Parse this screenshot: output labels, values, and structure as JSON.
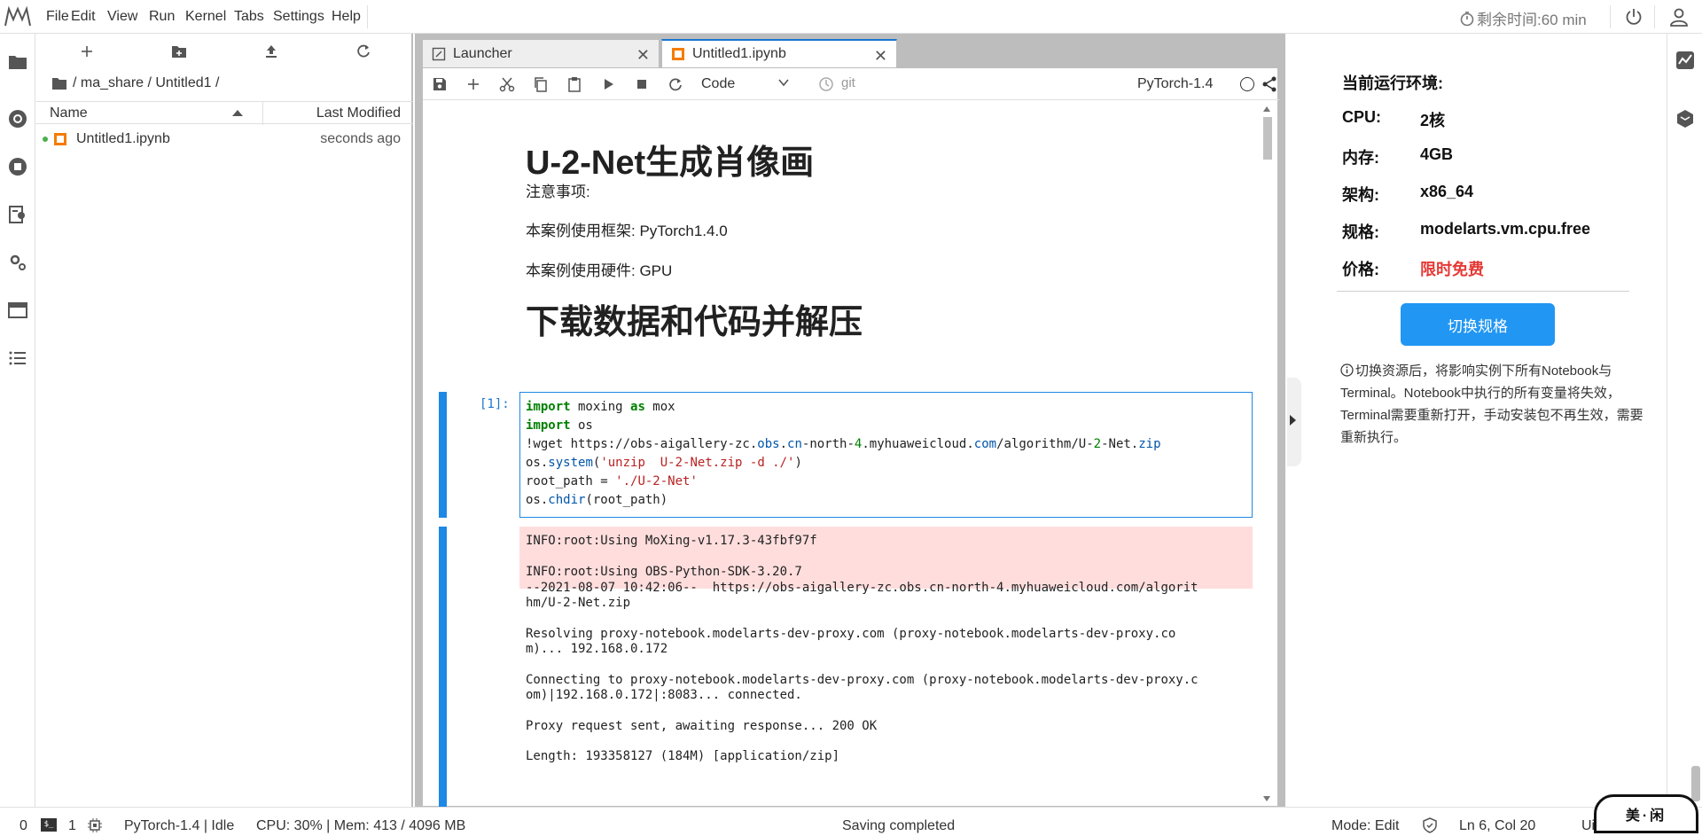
{
  "menubar": {
    "items": [
      "File",
      "Edit",
      "View",
      "Run",
      "Kernel",
      "Tabs",
      "Settings",
      "Help"
    ],
    "timer_label": "剩余时间:60 min"
  },
  "filebrowser": {
    "breadcrumb": "/ ma_share / Untitled1 /",
    "col_name": "Name",
    "col_modified": "Last Modified",
    "files": [
      {
        "name": "Untitled1.ipynb",
        "modified": "seconds ago"
      }
    ]
  },
  "tabs": {
    "launcher": "Launcher",
    "notebook": "Untitled1.ipynb"
  },
  "toolbar": {
    "cell_type": "Code",
    "git_label": "git",
    "kernel": "PyTorch-1.4"
  },
  "notebook": {
    "title": "U-2-Net生成肖像画",
    "note_heading": "注意事项:",
    "framework": "本案例使用框架: PyTorch1.4.0",
    "hardware": "本案例使用硬件: GPU",
    "section2": "下载数据和代码并解压",
    "prompt": "[1]:",
    "code_lines": [
      "import moxing as mox",
      "import os",
      "!wget https://obs-aigallery-zc.obs.cn-north-4.myhuaweicloud.com/algorithm/U-2-Net.zip",
      "os.system('unzip  U-2-Net.zip -d ./')",
      "root_path = './U-2-Net'",
      "os.chdir(root_path)"
    ],
    "stderr_lines": [
      "INFO:root:Using MoXing-v1.17.3-43fbf97f",
      "",
      "INFO:root:Using OBS-Python-SDK-3.20.7"
    ],
    "stdout_lines": [
      "--2021-08-07 10:42:06--  https://obs-aigallery-zc.obs.cn-north-4.myhuaweicloud.com/algorit",
      "hm/U-2-Net.zip",
      "",
      "Resolving proxy-notebook.modelarts-dev-proxy.com (proxy-notebook.modelarts-dev-proxy.co",
      "m)... 192.168.0.172",
      "",
      "Connecting to proxy-notebook.modelarts-dev-proxy.com (proxy-notebook.modelarts-dev-proxy.c",
      "om)|192.168.0.172|:8083... connected.",
      "",
      "Proxy request sent, awaiting response... 200 OK",
      "",
      "Length: 193358127 (184M) [application/zip]"
    ]
  },
  "resources": {
    "title": "当前运行环境:",
    "cpu_label": "CPU:",
    "cpu_value": "2核",
    "mem_label": "内存:",
    "mem_value": "4GB",
    "arch_label": "架构:",
    "arch_value": "x86_64",
    "spec_label": "规格:",
    "spec_value": "modelarts.vm.cpu.free",
    "price_label": "价格:",
    "price_value": "限时免费",
    "switch_button": "切换规格",
    "notice": "切换资源后，将影响实例下所有Notebook与Terminal。Notebook中执行的所有变量将失效，Terminal需要重新打开，手动安装包不再生效，需要重新执行。"
  },
  "statusbar": {
    "left_count": "0",
    "term_count": "1",
    "kernel_status": "PyTorch-1.4 | Idle",
    "resource": "CPU: 30% | Mem: 413 / 4096 MB",
    "save_status": "Saving completed",
    "mode": "Mode: Edit",
    "cursor": "Ln 6, Col 20",
    "encoding": "Ui",
    "widget_text": "美·闲"
  },
  "colors": {
    "accent": "#1e88e5",
    "price": "#e53935",
    "stderr_bg": "#ffdddd",
    "running_dot": "#4caf50",
    "notebook_icon": "#f57c00"
  }
}
